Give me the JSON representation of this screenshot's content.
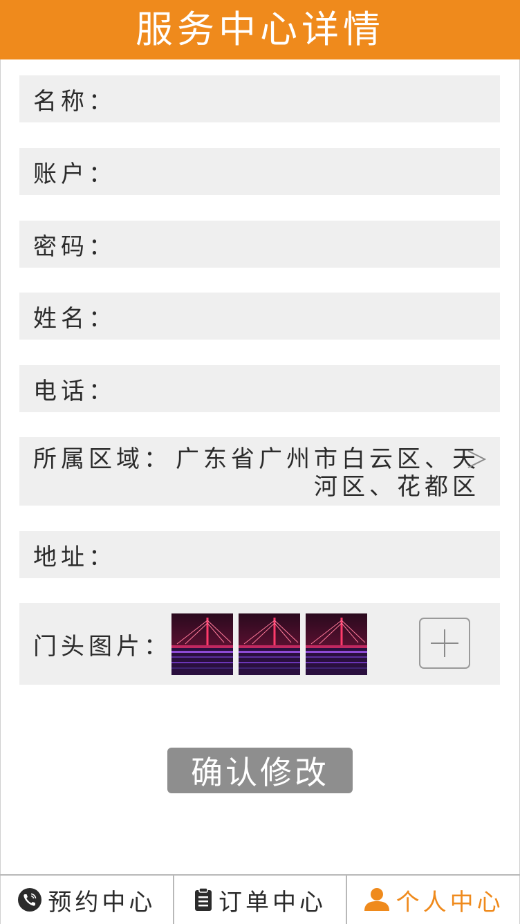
{
  "header": {
    "title": "服务中心详情"
  },
  "fields": [
    {
      "label": "名称：",
      "value": ""
    },
    {
      "label": "账户：",
      "value": ""
    },
    {
      "label": "密码：",
      "value": ""
    },
    {
      "label": "姓名：",
      "value": ""
    },
    {
      "label": "电话：",
      "value": ""
    }
  ],
  "region": {
    "label": "所属区域：",
    "value": "广东省广州市白云区、天河区、花都区"
  },
  "address": {
    "label": "地址：",
    "value": ""
  },
  "photos": {
    "label": "门头图片：",
    "count": 3
  },
  "confirm_label": "确认修改",
  "tabs": [
    {
      "label": "预约中心",
      "icon": "phone-icon"
    },
    {
      "label": "订单中心",
      "icon": "clipboard-icon"
    },
    {
      "label": "个人中心",
      "icon": "user-icon",
      "active": true
    }
  ],
  "colors": {
    "accent": "#ef8a1c",
    "button": "#8e8e8e",
    "row_bg": "#efefef"
  }
}
